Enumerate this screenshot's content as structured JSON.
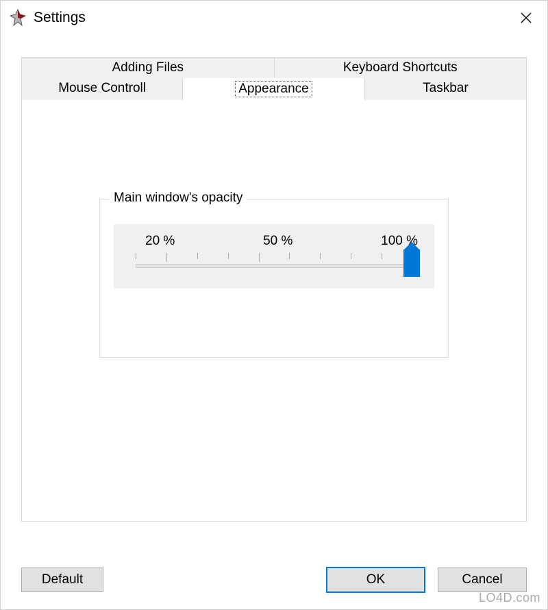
{
  "window": {
    "title": "Settings"
  },
  "tabs": {
    "row1": [
      {
        "label": "Adding Files"
      },
      {
        "label": "Keyboard Shortcuts"
      }
    ],
    "row2": [
      {
        "label": "Mouse Controll"
      },
      {
        "label": "Appearance",
        "active": true
      },
      {
        "label": "Taskbar"
      }
    ]
  },
  "appearance": {
    "group_title": "Main window's opacity",
    "slider": {
      "min": 10,
      "max": 100,
      "value": 100,
      "tick_labels": [
        "20 %",
        "50 %",
        "100 %"
      ]
    }
  },
  "buttons": {
    "default": "Default",
    "ok": "OK",
    "cancel": "Cancel"
  },
  "watermark": "LO4D.com"
}
